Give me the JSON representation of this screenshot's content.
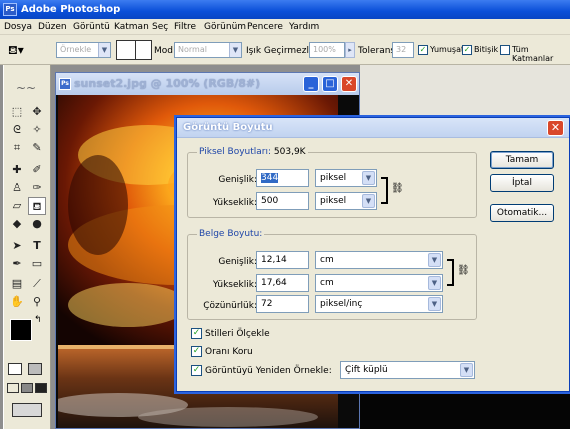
{
  "app": {
    "title": "Adobe Photoshop",
    "logo_text": "Ps"
  },
  "menu": [
    "Dosya",
    "Düzen",
    "Görüntü",
    "Katman",
    "Seç",
    "Filtre",
    "Görünüm",
    "Pencere",
    "Yardım"
  ],
  "options_bar": {
    "style_value": "Örnekle",
    "mode_label": "Mod:",
    "mode_value": "Normal",
    "opacity_label": "Işık Geçirmezlik:",
    "opacity_value": "100%",
    "tolerance_label": "Tolerans:",
    "tolerance_value": "32",
    "checkboxes": [
      {
        "label": "Yumuşat",
        "checked": true
      },
      {
        "label": "Bitişik",
        "checked": true
      },
      {
        "label": "Tüm Katmanlar",
        "checked": false
      }
    ]
  },
  "image_window": {
    "title": "sunset2.jpg @ 100% (RGB/8#)"
  },
  "tools": [
    "marquee-tool",
    "move-tool",
    "lasso-tool",
    "magic-wand-tool",
    "crop-tool",
    "slice-tool",
    "healing-brush-tool",
    "brush-tool",
    "clone-stamp-tool",
    "history-brush-tool",
    "eraser-tool",
    "paint-bucket-tool",
    "blur-tool",
    "dodge-tool",
    "path-selection-tool",
    "type-tool",
    "pen-tool",
    "shape-tool",
    "notes-tool",
    "eyedropper-tool",
    "hand-tool",
    "zoom-tool"
  ],
  "dialog": {
    "title": "Görüntü Boyutu",
    "pixel_group": {
      "label": "Piksel Boyutları:",
      "size": "503,9K",
      "width_label": "Genişlik:",
      "width_value": "344",
      "width_unit": "piksel",
      "height_label": "Yükseklik:",
      "height_value": "500",
      "height_unit": "piksel"
    },
    "doc_group": {
      "label": "Belge Boyutu:",
      "width_label": "Genişlik:",
      "width_value": "12,14",
      "width_unit": "cm",
      "height_label": "Yükseklik:",
      "height_value": "17,64",
      "height_unit": "cm",
      "res_label": "Çözünürlük:",
      "res_value": "72",
      "res_unit": "piksel/inç"
    },
    "options": [
      {
        "label": "Stilleri Ölçekle",
        "checked": true
      },
      {
        "label": "Oranı Koru",
        "checked": true
      },
      {
        "label": "Görüntüyü Yeniden Örnekle:",
        "checked": true
      }
    ],
    "resample_value": "Çift küplü",
    "buttons": {
      "ok": "Tamam",
      "cancel": "İptal",
      "auto": "Otomatik..."
    }
  },
  "colors": {
    "title_blue": "#0a4fd8",
    "dialog_bg": "#ece9d8",
    "close_red": "#d9472a"
  }
}
